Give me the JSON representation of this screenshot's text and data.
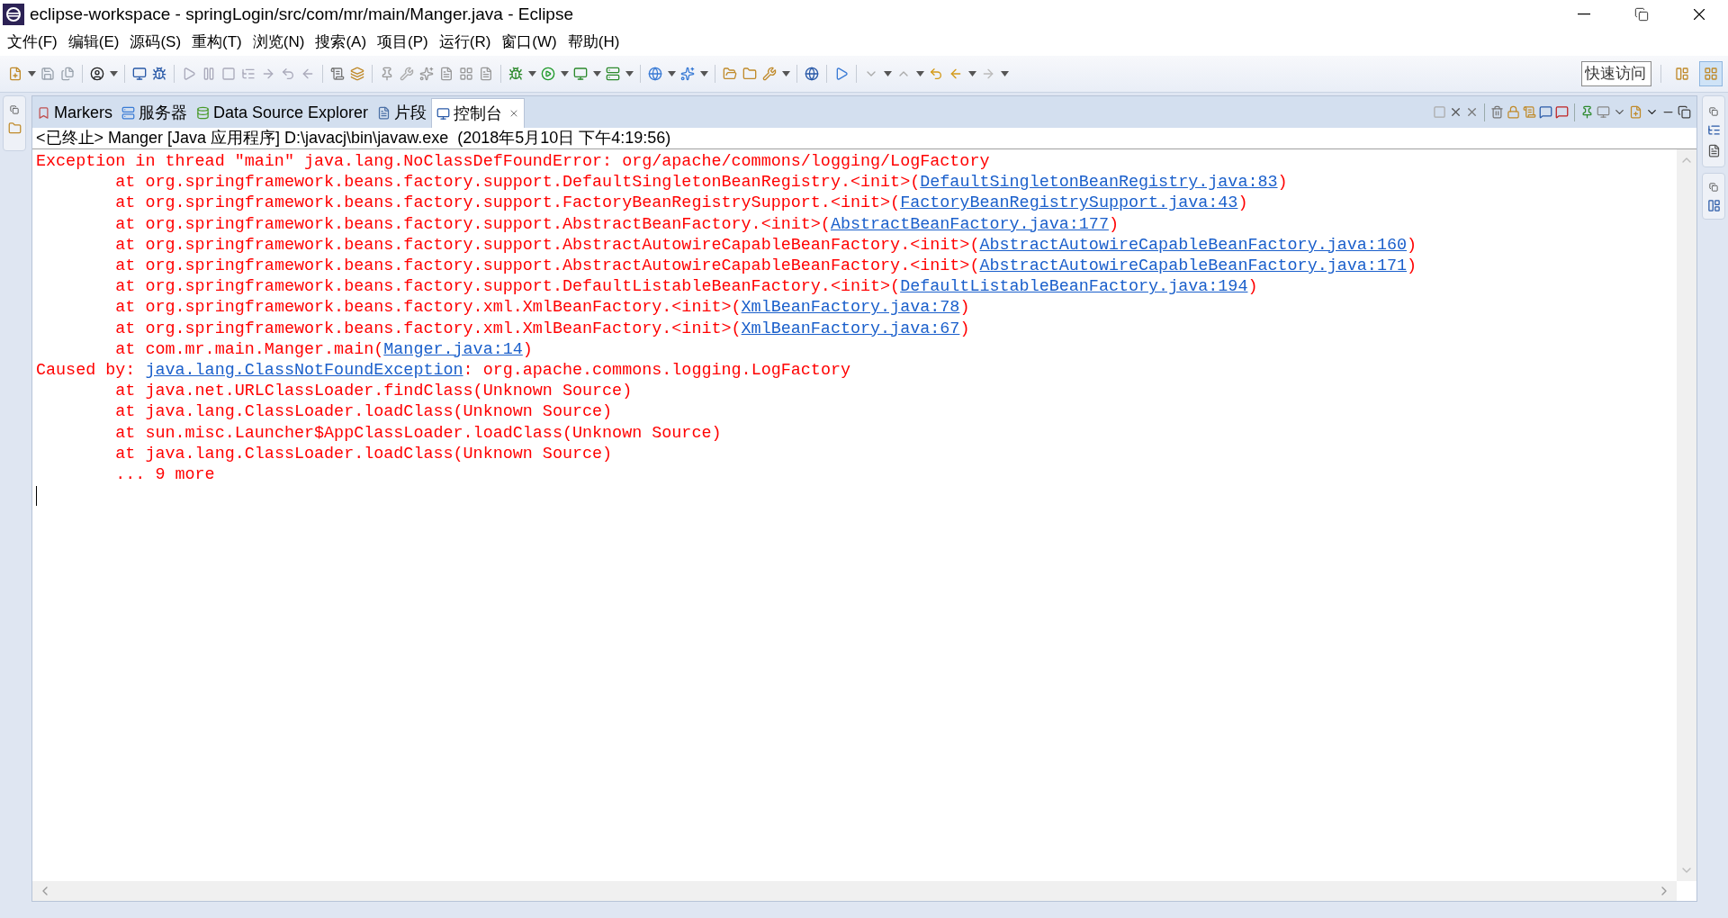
{
  "window": {
    "title": "eclipse-workspace - springLogin/src/com/mr/main/Manger.java - Eclipse"
  },
  "menu": [
    "文件(F)",
    "编辑(E)",
    "源码(S)",
    "重构(T)",
    "浏览(N)",
    "搜索(A)",
    "项目(P)",
    "运行(R)",
    "窗口(W)",
    "帮助(H)"
  ],
  "toolbar": {
    "quick_access": {
      "placeholder": "快速访问"
    }
  },
  "view_tabs": [
    {
      "label": "Markers",
      "kind": "markers",
      "selected": false,
      "closable": false
    },
    {
      "label": "服务器",
      "kind": "servers",
      "selected": false,
      "closable": false
    },
    {
      "label": "Data Source Explorer",
      "kind": "datasource",
      "selected": false,
      "closable": false
    },
    {
      "label": "片段",
      "kind": "snippets",
      "selected": false,
      "closable": false
    },
    {
      "label": "控制台",
      "kind": "console",
      "selected": true,
      "closable": true
    }
  ],
  "console": {
    "header": "<已终止> Manger [Java 应用程序] D:\\javacj\\bin\\javaw.exe  (2018年5月10日 下午4:19:56)",
    "lines": [
      {
        "segments": [
          {
            "kind": "text",
            "text": "Exception in thread \"main\" java.lang.NoClassDefFoundError: org/apache/commons/logging/LogFactory"
          }
        ]
      },
      {
        "segments": [
          {
            "kind": "text",
            "text": "\tat org.springframework.beans.factory.support.DefaultSingletonBeanRegistry.<init>("
          },
          {
            "kind": "link",
            "text": "DefaultSingletonBeanRegistry.java:83"
          },
          {
            "kind": "text",
            "text": ")"
          }
        ]
      },
      {
        "segments": [
          {
            "kind": "text",
            "text": "\tat org.springframework.beans.factory.support.FactoryBeanRegistrySupport.<init>("
          },
          {
            "kind": "link",
            "text": "FactoryBeanRegistrySupport.java:43"
          },
          {
            "kind": "text",
            "text": ")"
          }
        ]
      },
      {
        "segments": [
          {
            "kind": "text",
            "text": "\tat org.springframework.beans.factory.support.AbstractBeanFactory.<init>("
          },
          {
            "kind": "link",
            "text": "AbstractBeanFactory.java:177"
          },
          {
            "kind": "text",
            "text": ")"
          }
        ]
      },
      {
        "segments": [
          {
            "kind": "text",
            "text": "\tat org.springframework.beans.factory.support.AbstractAutowireCapableBeanFactory.<init>("
          },
          {
            "kind": "link",
            "text": "AbstractAutowireCapableBeanFactory.java:160"
          },
          {
            "kind": "text",
            "text": ")"
          }
        ]
      },
      {
        "segments": [
          {
            "kind": "text",
            "text": "\tat org.springframework.beans.factory.support.AbstractAutowireCapableBeanFactory.<init>("
          },
          {
            "kind": "link",
            "text": "AbstractAutowireCapableBeanFactory.java:171"
          },
          {
            "kind": "text",
            "text": ")"
          }
        ]
      },
      {
        "segments": [
          {
            "kind": "text",
            "text": "\tat org.springframework.beans.factory.support.DefaultListableBeanFactory.<init>("
          },
          {
            "kind": "link",
            "text": "DefaultListableBeanFactory.java:194"
          },
          {
            "kind": "text",
            "text": ")"
          }
        ]
      },
      {
        "segments": [
          {
            "kind": "text",
            "text": "\tat org.springframework.beans.factory.xml.XmlBeanFactory.<init>("
          },
          {
            "kind": "link",
            "text": "XmlBeanFactory.java:78"
          },
          {
            "kind": "text",
            "text": ")"
          }
        ]
      },
      {
        "segments": [
          {
            "kind": "text",
            "text": "\tat org.springframework.beans.factory.xml.XmlBeanFactory.<init>("
          },
          {
            "kind": "link",
            "text": "XmlBeanFactory.java:67"
          },
          {
            "kind": "text",
            "text": ")"
          }
        ]
      },
      {
        "segments": [
          {
            "kind": "text",
            "text": "\tat com.mr.main.Manger.main("
          },
          {
            "kind": "link",
            "text": "Manger.java:14"
          },
          {
            "kind": "text",
            "text": ")"
          }
        ]
      },
      {
        "segments": [
          {
            "kind": "text",
            "text": "Caused by: "
          },
          {
            "kind": "link",
            "text": "java.lang.ClassNotFoundException"
          },
          {
            "kind": "text",
            "text": ": org.apache.commons.logging.LogFactory"
          }
        ]
      },
      {
        "segments": [
          {
            "kind": "text",
            "text": "\tat java.net.URLClassLoader.findClass(Unknown Source)"
          }
        ]
      },
      {
        "segments": [
          {
            "kind": "text",
            "text": "\tat java.lang.ClassLoader.loadClass(Unknown Source)"
          }
        ]
      },
      {
        "segments": [
          {
            "kind": "text",
            "text": "\tat sun.misc.Launcher$AppClassLoader.loadClass(Unknown Source)"
          }
        ]
      },
      {
        "segments": [
          {
            "kind": "text",
            "text": "\tat java.lang.ClassLoader.loadClass(Unknown Source)"
          }
        ]
      },
      {
        "segments": [
          {
            "kind": "text",
            "text": "\t... 9 more"
          }
        ]
      }
    ],
    "cursor": true
  }
}
